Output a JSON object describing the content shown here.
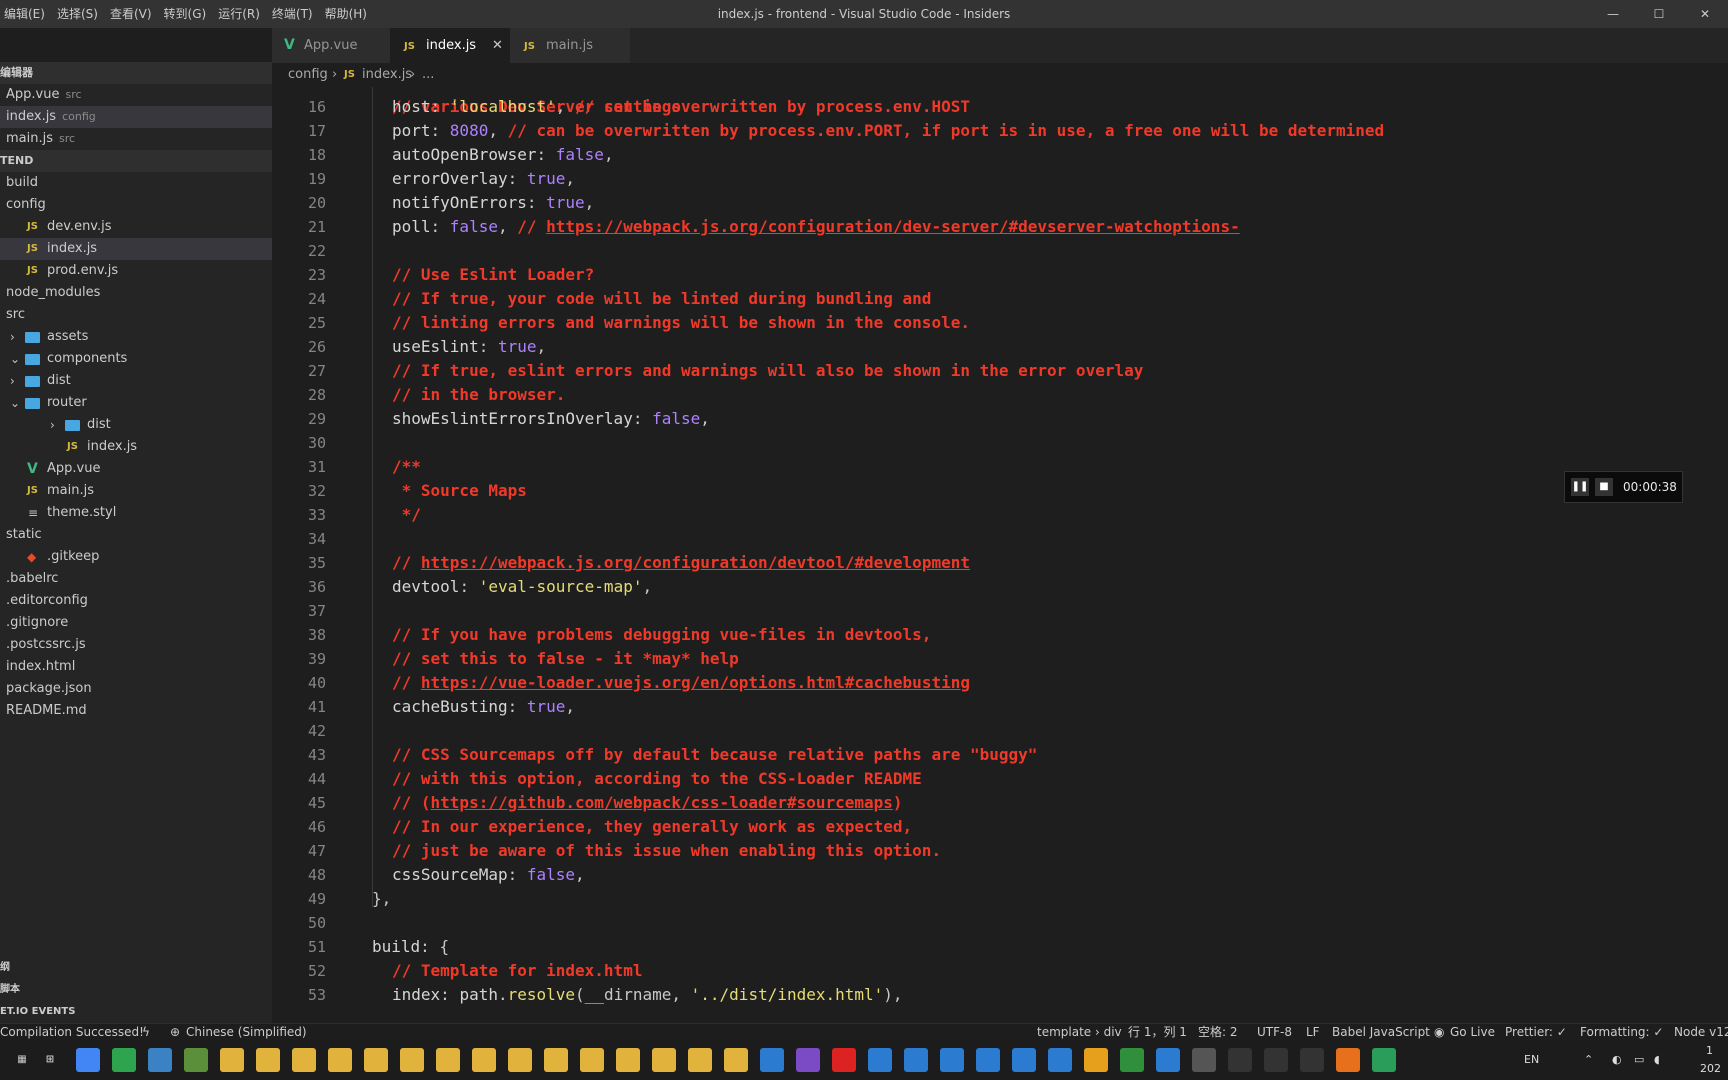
{
  "menu": [
    "编辑(E)",
    "选择(S)",
    "查看(V)",
    "转到(G)",
    "运行(R)",
    "终端(T)",
    "帮助(H)"
  ],
  "window_title": "index.js - frontend - Visual Studio Code - Insiders",
  "window_controls": [
    "—",
    "☐",
    "✕"
  ],
  "explorer": {
    "open_editors_title": "编辑器",
    "open_editors": [
      {
        "name": "App.vue",
        "desc": "src"
      },
      {
        "name": "index.js",
        "desc": "config"
      },
      {
        "name": "main.js",
        "desc": "src"
      }
    ],
    "project_title": "TEND",
    "tree": [
      {
        "name": "build",
        "type": "folder-plain",
        "depth": 0
      },
      {
        "name": "config",
        "type": "folder-plain",
        "depth": 0
      },
      {
        "name": "dev.env.js",
        "type": "js",
        "depth": 1
      },
      {
        "name": "index.js",
        "type": "js",
        "depth": 1,
        "active": true
      },
      {
        "name": "prod.env.js",
        "type": "js",
        "depth": 1
      },
      {
        "name": "node_modules",
        "type": "folder-plain",
        "depth": 0
      },
      {
        "name": "src",
        "type": "folder-plain",
        "depth": 0
      },
      {
        "name": "assets",
        "type": "folder-closed",
        "depth": 1
      },
      {
        "name": "components",
        "type": "folder-open",
        "depth": 1
      },
      {
        "name": "dist",
        "type": "folder-closed",
        "depth": 1
      },
      {
        "name": "router",
        "type": "folder-open",
        "depth": 1
      },
      {
        "name": "dist",
        "type": "folder-closed",
        "depth": 2
      },
      {
        "name": "index.js",
        "type": "js",
        "depth": 2
      },
      {
        "name": "App.vue",
        "type": "vue",
        "depth": 1
      },
      {
        "name": "main.js",
        "type": "js",
        "depth": 1
      },
      {
        "name": "theme.styl",
        "type": "file",
        "depth": 1
      },
      {
        "name": "static",
        "type": "folder-plain",
        "depth": 0
      },
      {
        "name": ".gitkeep",
        "type": "git",
        "depth": 1
      },
      {
        "name": ".babelrc",
        "type": "file-root",
        "depth": 0
      },
      {
        "name": ".editorconfig",
        "type": "file-root",
        "depth": 0
      },
      {
        "name": ".gitignore",
        "type": "file-root",
        "depth": 0
      },
      {
        "name": ".postcssrc.js",
        "type": "file-root",
        "depth": 0
      },
      {
        "name": "index.html",
        "type": "file-root",
        "depth": 0
      },
      {
        "name": "package.json",
        "type": "file-root",
        "depth": 0
      },
      {
        "name": "README.md",
        "type": "file-root",
        "depth": 0
      }
    ],
    "bottom_sections": [
      "纲",
      "脚本",
      "ET.IO EVENTS"
    ]
  },
  "tabs": [
    {
      "label": "App.vue",
      "type": "vue"
    },
    {
      "label": "index.js",
      "type": "js",
      "active": true
    },
    {
      "label": "main.js",
      "type": "js"
    }
  ],
  "breadcrumb": {
    "folder": "config",
    "file": "index.js",
    "more": "..."
  },
  "code_lines": [
    {
      "n": "16",
      "ind": 1,
      "t": [
        [
          "p",
          "host"
        ],
        [
          "pu",
          ": "
        ],
        [
          "s",
          "'localhost'"
        ],
        [
          "pu",
          ", "
        ],
        [
          "c",
          "// can be overwritten by process.env.HOST"
        ]
      ]
    },
    {
      "n": "17",
      "ind": 1,
      "t": [
        [
          "p",
          "port"
        ],
        [
          "pu",
          ": "
        ],
        [
          "b",
          "8080"
        ],
        [
          "pu",
          ", "
        ],
        [
          "c",
          "// can be overwritten by process.env.PORT, if port is in use, a free one will be determined"
        ]
      ]
    },
    {
      "n": "18",
      "ind": 1,
      "t": [
        [
          "p",
          "autoOpenBrowser"
        ],
        [
          "pu",
          ": "
        ],
        [
          "b",
          "false"
        ],
        [
          "pu",
          ","
        ]
      ]
    },
    {
      "n": "19",
      "ind": 1,
      "t": [
        [
          "p",
          "errorOverlay"
        ],
        [
          "pu",
          ": "
        ],
        [
          "b",
          "true"
        ],
        [
          "pu",
          ","
        ]
      ]
    },
    {
      "n": "20",
      "ind": 1,
      "t": [
        [
          "p",
          "notifyOnErrors"
        ],
        [
          "pu",
          ": "
        ],
        [
          "b",
          "true"
        ],
        [
          "pu",
          ","
        ]
      ]
    },
    {
      "n": "21",
      "ind": 1,
      "t": [
        [
          "p",
          "poll"
        ],
        [
          "pu",
          ": "
        ],
        [
          "b",
          "false"
        ],
        [
          "pu",
          ", "
        ],
        [
          "c",
          "// "
        ],
        [
          "cu",
          "https://webpack.js.org/configuration/dev-server/#devserver-watchoptions-"
        ]
      ]
    },
    {
      "n": "22",
      "ind": 1,
      "t": []
    },
    {
      "n": "23",
      "ind": 1,
      "t": [
        [
          "c",
          "// Use Eslint Loader?"
        ]
      ]
    },
    {
      "n": "24",
      "ind": 1,
      "t": [
        [
          "c",
          "// If true, your code will be linted during bundling and"
        ]
      ]
    },
    {
      "n": "25",
      "ind": 1,
      "t": [
        [
          "c",
          "// linting errors and warnings will be shown in the console."
        ]
      ]
    },
    {
      "n": "26",
      "ind": 1,
      "t": [
        [
          "p",
          "useEslint"
        ],
        [
          "pu",
          ": "
        ],
        [
          "b",
          "true"
        ],
        [
          "pu",
          ","
        ]
      ]
    },
    {
      "n": "27",
      "ind": 1,
      "t": [
        [
          "c",
          "// If true, eslint errors and warnings will also be shown in the error overlay"
        ]
      ]
    },
    {
      "n": "28",
      "ind": 1,
      "t": [
        [
          "c",
          "// in the browser."
        ]
      ]
    },
    {
      "n": "29",
      "ind": 1,
      "t": [
        [
          "p",
          "showEslintErrorsInOverlay"
        ],
        [
          "pu",
          ": "
        ],
        [
          "b",
          "false"
        ],
        [
          "pu",
          ","
        ]
      ]
    },
    {
      "n": "30",
      "ind": 1,
      "t": []
    },
    {
      "n": "31",
      "ind": 1,
      "t": [
        [
          "c",
          "/**"
        ]
      ]
    },
    {
      "n": "32",
      "ind": 1,
      "t": [
        [
          "c",
          " * Source Maps"
        ]
      ]
    },
    {
      "n": "33",
      "ind": 1,
      "t": [
        [
          "c",
          " */"
        ]
      ]
    },
    {
      "n": "34",
      "ind": 1,
      "t": []
    },
    {
      "n": "35",
      "ind": 1,
      "t": [
        [
          "c",
          "// "
        ],
        [
          "cu",
          "https://webpack.js.org/configuration/devtool/#development"
        ]
      ]
    },
    {
      "n": "36",
      "ind": 1,
      "t": [
        [
          "p",
          "devtool"
        ],
        [
          "pu",
          ": "
        ],
        [
          "s",
          "'eval-source-map'"
        ],
        [
          "pu",
          ","
        ]
      ]
    },
    {
      "n": "37",
      "ind": 1,
      "t": []
    },
    {
      "n": "38",
      "ind": 1,
      "t": [
        [
          "c",
          "// If you have problems debugging vue-files in devtools,"
        ]
      ]
    },
    {
      "n": "39",
      "ind": 1,
      "t": [
        [
          "c",
          "// set this to false - it *may* help"
        ]
      ]
    },
    {
      "n": "40",
      "ind": 1,
      "t": [
        [
          "c",
          "// "
        ],
        [
          "cu",
          "https://vue-loader.vuejs.org/en/options.html#cachebusting"
        ]
      ]
    },
    {
      "n": "41",
      "ind": 1,
      "t": [
        [
          "p",
          "cacheBusting"
        ],
        [
          "pu",
          ": "
        ],
        [
          "b",
          "true"
        ],
        [
          "pu",
          ","
        ]
      ]
    },
    {
      "n": "42",
      "ind": 1,
      "t": []
    },
    {
      "n": "43",
      "ind": 1,
      "t": [
        [
          "c",
          "// CSS Sourcemaps off by default because relative paths are \"buggy\""
        ]
      ]
    },
    {
      "n": "44",
      "ind": 1,
      "t": [
        [
          "c",
          "// with this option, according to the CSS-Loader README"
        ]
      ]
    },
    {
      "n": "45",
      "ind": 1,
      "t": [
        [
          "c",
          "// ("
        ],
        [
          "cu",
          "https://github.com/webpack/css-loader#sourcemaps"
        ],
        [
          "c",
          ")"
        ]
      ]
    },
    {
      "n": "46",
      "ind": 1,
      "t": [
        [
          "c",
          "// In our experience, they generally work as expected,"
        ]
      ]
    },
    {
      "n": "47",
      "ind": 1,
      "t": [
        [
          "c",
          "// just be aware of this issue when enabling this option."
        ]
      ]
    },
    {
      "n": "48",
      "ind": 1,
      "t": [
        [
          "p",
          "cssSourceMap"
        ],
        [
          "pu",
          ": "
        ],
        [
          "b",
          "false"
        ],
        [
          "pu",
          ","
        ]
      ]
    },
    {
      "n": "49",
      "ind": 0,
      "t": [
        [
          "pu",
          "},"
        ]
      ]
    },
    {
      "n": "50",
      "ind": 0,
      "t": []
    },
    {
      "n": "51",
      "ind": 0,
      "t": [
        [
          "p",
          "build"
        ],
        [
          "pu",
          ": {"
        ]
      ]
    },
    {
      "n": "52",
      "ind": 1,
      "t": [
        [
          "c",
          "// Template for index.html"
        ]
      ]
    },
    {
      "n": "53",
      "ind": 1,
      "t": [
        [
          "p",
          "index"
        ],
        [
          "pu",
          ": "
        ],
        [
          "p",
          "path"
        ],
        [
          "pu",
          "."
        ],
        [
          "s",
          "resolve"
        ],
        [
          "pu",
          "(__dirname, "
        ],
        [
          "s",
          "'../dist/index.html'"
        ],
        [
          "pu",
          "),"
        ]
      ]
    }
  ],
  "recorder": {
    "pause": "❚❚",
    "stop": "■",
    "time": "00:00:38"
  },
  "status": {
    "compilation": "Compilation Successed!",
    "language_pack": "Chinese (Simplified)",
    "template": "template › div",
    "position": "行 1，列 1",
    "spaces": "空格: 2",
    "encoding": "UTF-8",
    "eol": "LF",
    "language": "Babel JavaScript",
    "golive": "Go Live",
    "prettier": "Prettier: ✓",
    "formatting": "Formatting: ✓",
    "node": "Node v12."
  },
  "taskbar": {
    "lang": "EN",
    "clock_a": "1",
    "clock_b": "202"
  },
  "colors": {
    "comment": "#ef3a2a",
    "keyword": "#ae81ff",
    "string": "#e6db74",
    "sidebar": "#252526",
    "editor": "#1e1e1e"
  }
}
